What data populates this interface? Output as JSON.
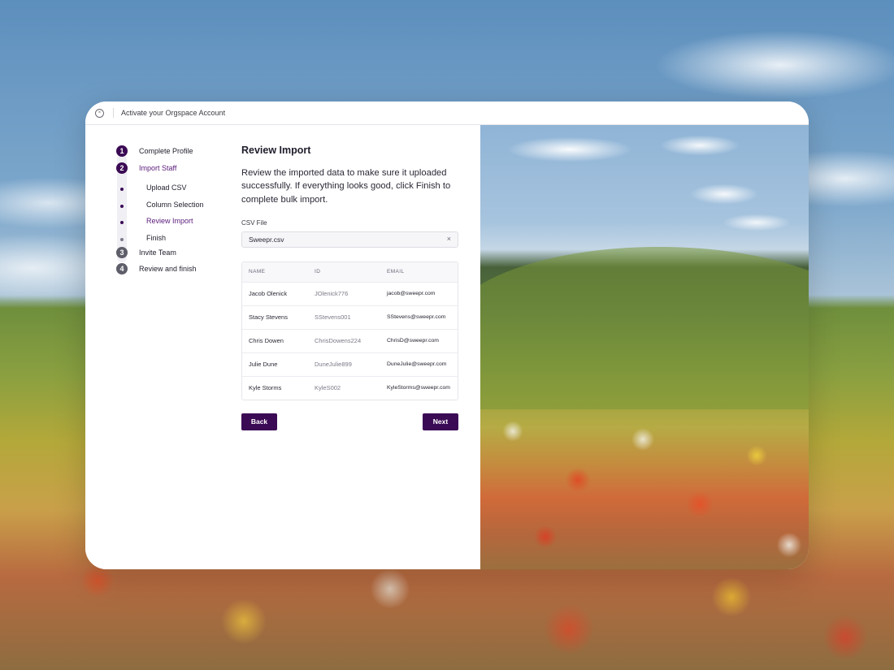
{
  "window": {
    "title": "Activate your Orgspace Account"
  },
  "stepper": {
    "steps": [
      {
        "number": "1",
        "label": "Complete Profile"
      },
      {
        "number": "2",
        "label": "Import Staff"
      },
      {
        "number": "3",
        "label": "Invite Team"
      },
      {
        "number": "4",
        "label": "Review and finish"
      }
    ],
    "substeps": [
      {
        "label": "Upload CSV"
      },
      {
        "label": "Column Selection"
      },
      {
        "label": "Review Import"
      },
      {
        "label": "Finish"
      }
    ]
  },
  "main": {
    "title": "Review Import",
    "description": "Review the imported data to make sure it uploaded successfully. If everything looks good, click Finish to complete bulk import.",
    "file_label": "CSV File",
    "file_name": "Sweepr.csv",
    "clear_glyph": "×"
  },
  "table": {
    "headers": {
      "name": "NAME",
      "id": "ID",
      "email": "EMAIL"
    },
    "rows": [
      {
        "name": "Jacob Olenick",
        "id": "JOlenick776",
        "email": "jacob@sweepr.com"
      },
      {
        "name": "Stacy Stevens",
        "id": "SStevens001",
        "email": "SStevens@sweepr.com"
      },
      {
        "name": "Chris Dowen",
        "id": "ChrisDowens224",
        "email": "ChrisD@sweepr.com"
      },
      {
        "name": "Julie Dune",
        "id": "DuneJulie899",
        "email": "DuneJulie@sweepr.com"
      },
      {
        "name": "Kyle Storms",
        "id": "KyleS002",
        "email": "KyleStorms@sweepr.com"
      }
    ]
  },
  "actions": {
    "back_label": "Back",
    "next_label": "Next"
  },
  "colors": {
    "accent": "#3b0a54",
    "accent_text": "#5a1a7a"
  }
}
